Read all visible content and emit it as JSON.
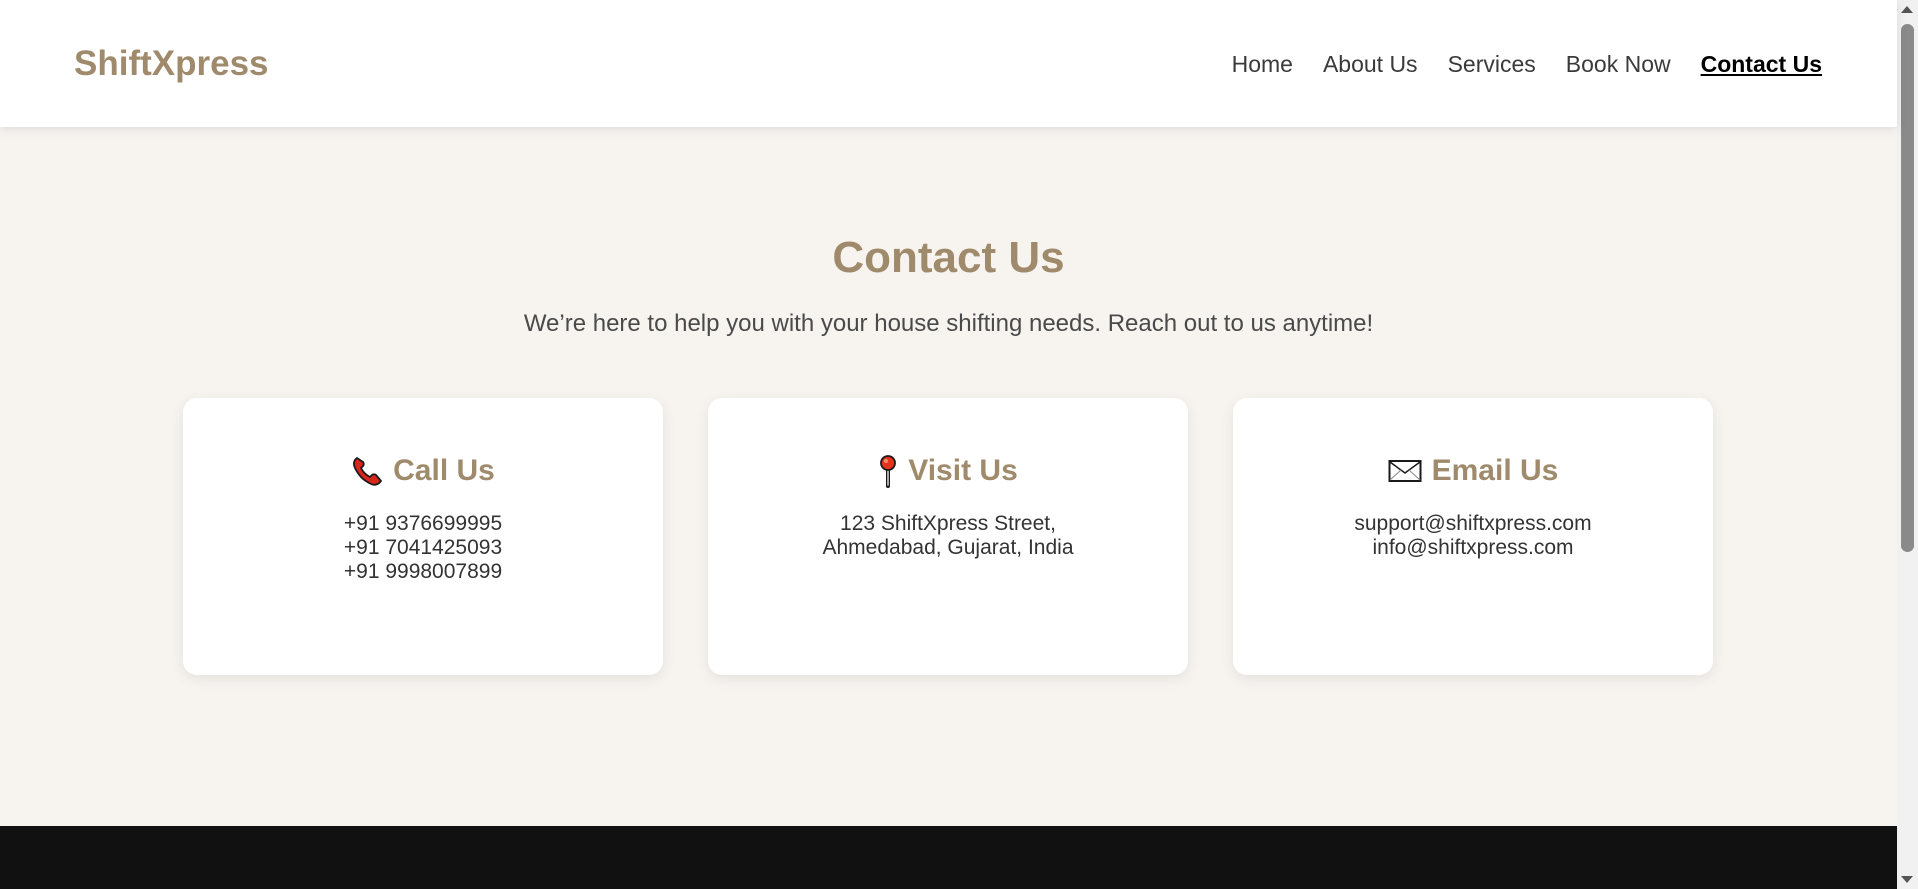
{
  "brand": {
    "name": "ShiftXpress",
    "color": "#a08a6c"
  },
  "nav": {
    "items": [
      {
        "label": "Home"
      },
      {
        "label": "About Us"
      },
      {
        "label": "Services"
      },
      {
        "label": "Book Now"
      },
      {
        "label": "Contact Us",
        "active": true
      }
    ]
  },
  "hero": {
    "title": "Contact Us",
    "subtitle": "We’re here to help you with your house shifting needs. Reach out to us anytime!"
  },
  "cards": [
    {
      "title": "Call Us",
      "icon": "phone-icon",
      "lines": [
        "+91 9376699995",
        "+91 7041425093",
        "+91 9998007899"
      ]
    },
    {
      "title": "Visit Us",
      "icon": "map-pin-icon",
      "lines": [
        "123 ShiftXpress Street,",
        "Ahmedabad, Gujarat, India"
      ]
    },
    {
      "title": "Email Us",
      "icon": "envelope-icon",
      "lines": [
        "support@shiftxpress.com",
        "info@shiftxpress.com"
      ]
    }
  ],
  "colors": {
    "accent": "#a08a6c",
    "background": "#f7f4f0",
    "footer": "#111111"
  }
}
